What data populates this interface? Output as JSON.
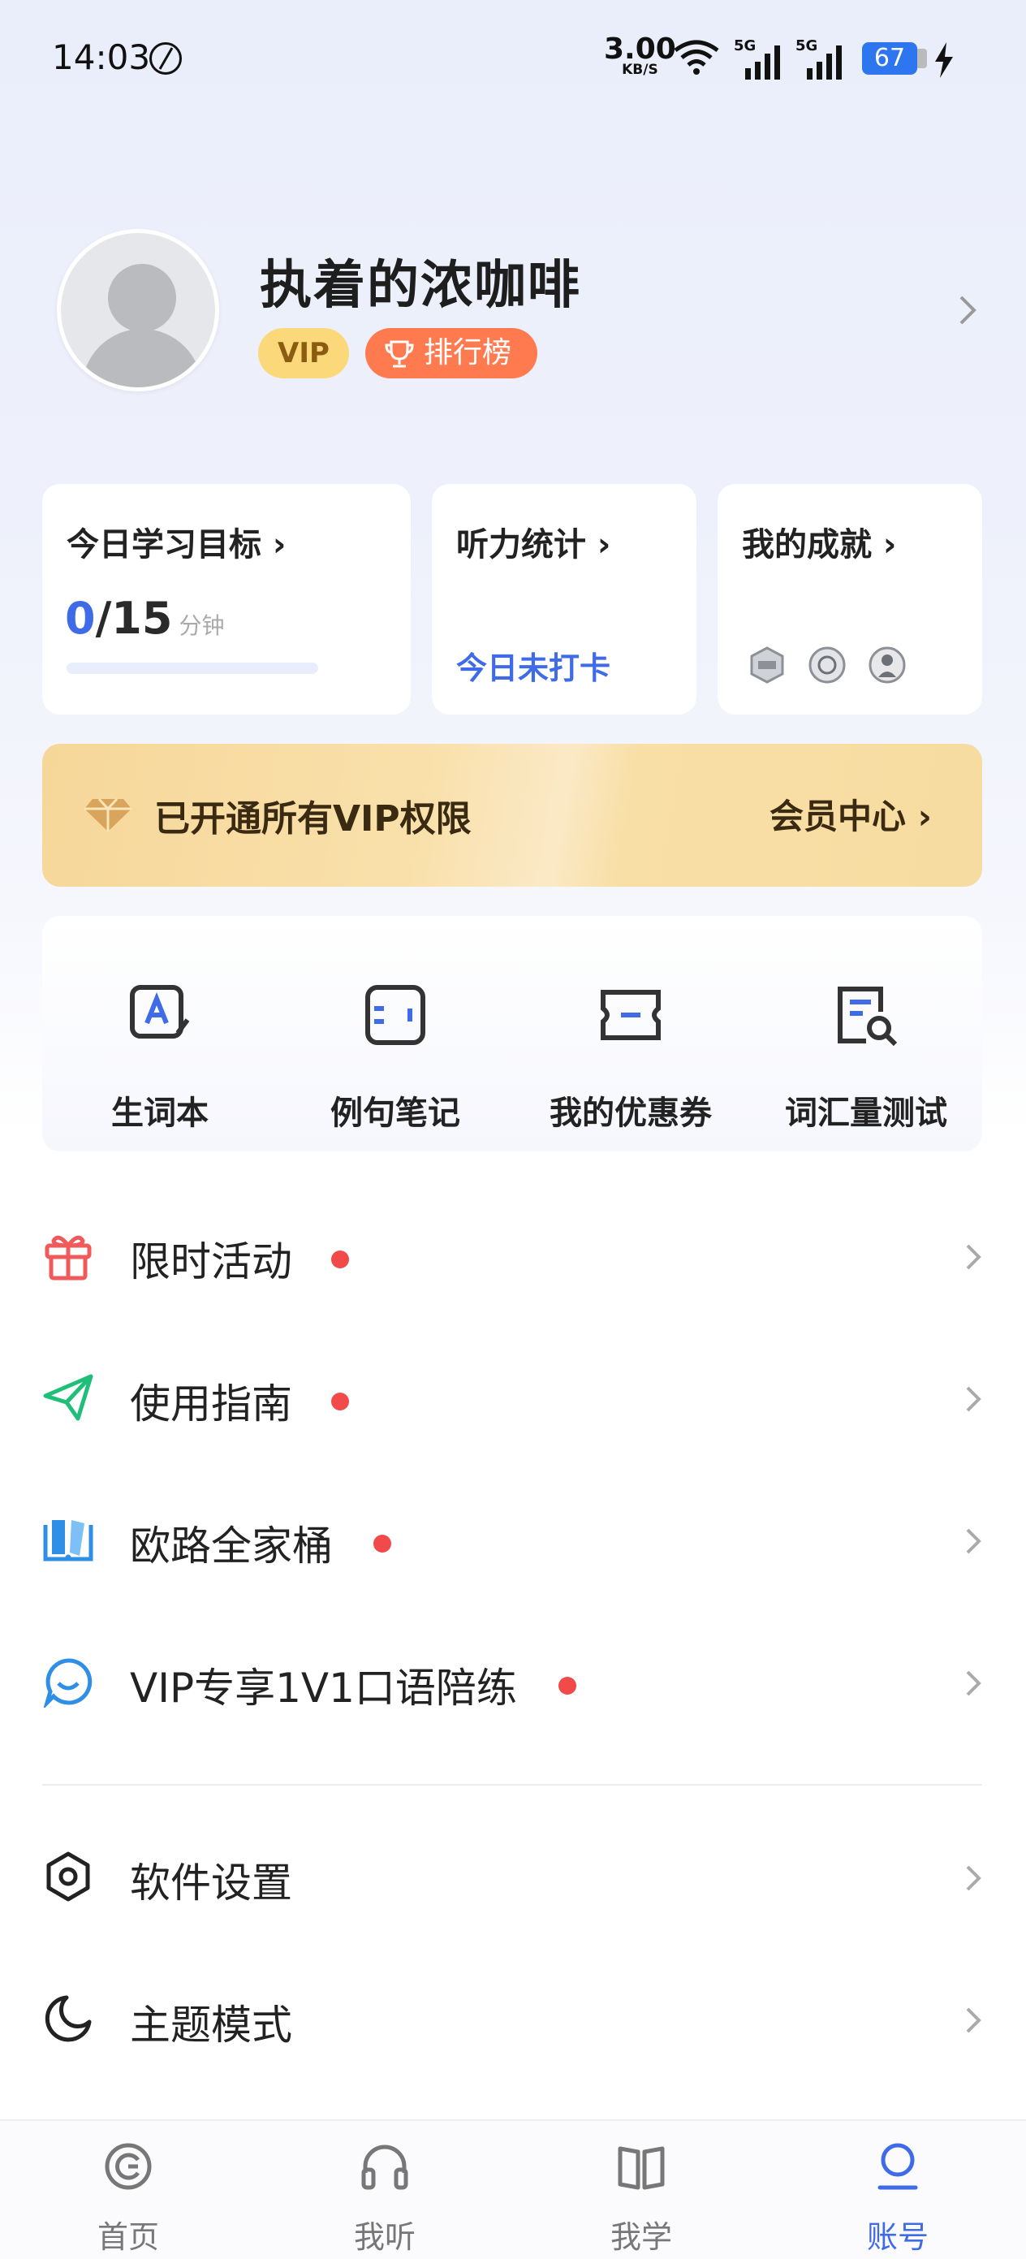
{
  "status_bar": {
    "time": "14:03",
    "speed_value": "3.00",
    "speed_unit": "KB/S",
    "sim1": "5G",
    "sim2": "5G",
    "battery": "67"
  },
  "profile": {
    "username": "执着的浓咖啡",
    "vip_badge": "VIP",
    "rank_badge": "排行榜"
  },
  "stats": {
    "goal": {
      "title": "今日学习目标 ›",
      "done": "0",
      "total": "/15",
      "unit": "分钟",
      "progress": 0
    },
    "listening": {
      "title": "听力统计 ›",
      "status": "今日未打卡"
    },
    "achievements": {
      "title": "我的成就 ›"
    }
  },
  "vip_banner": {
    "text": "已开通所有VIP权限",
    "center_link": "会员中心 ›"
  },
  "tools": [
    {
      "label": "生词本",
      "icon": "vocab-book-icon"
    },
    {
      "label": "例句笔记",
      "icon": "sentence-notes-icon"
    },
    {
      "label": "我的优惠券",
      "icon": "coupon-icon"
    },
    {
      "label": "词汇量测试",
      "icon": "vocab-test-icon"
    }
  ],
  "menu": [
    {
      "label": "限时活动",
      "icon": "gift-icon",
      "color": "#f05a5a",
      "dot": true
    },
    {
      "label": "使用指南",
      "icon": "paper-plane-icon",
      "color": "#1fbf7a",
      "dot": true
    },
    {
      "label": "欧路全家桶",
      "icon": "books-icon",
      "color": "#2f8ee6",
      "dot": true
    },
    {
      "label": "VIP专享1V1口语陪练",
      "icon": "chat-bubble-icon",
      "color": "#2f8ee6",
      "dot": true
    },
    {
      "label": "软件设置",
      "icon": "settings-hexagon-icon",
      "color": "#222222",
      "dot": false
    },
    {
      "label": "主题模式",
      "icon": "moon-icon",
      "color": "#222222",
      "dot": false
    }
  ],
  "bottom_nav": [
    {
      "label": "首页",
      "icon": "home-icon",
      "active": false
    },
    {
      "label": "我听",
      "icon": "headphones-icon",
      "active": false
    },
    {
      "label": "我学",
      "icon": "open-book-icon",
      "active": false
    },
    {
      "label": "账号",
      "icon": "account-icon",
      "active": true
    }
  ],
  "colors": {
    "accent": "#3f6be8",
    "vip_gold": "#fbd87a",
    "rank_orange": "#ff7a4f",
    "red_dot": "#f24a4a"
  }
}
